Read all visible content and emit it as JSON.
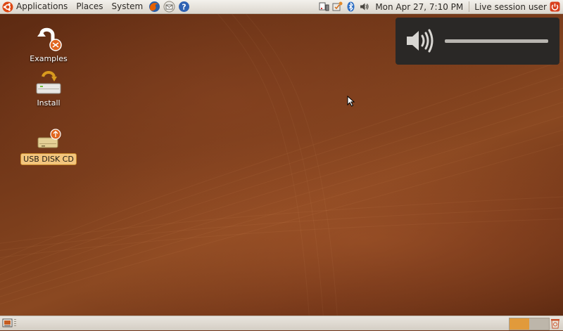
{
  "top_panel": {
    "menus": {
      "applications": "Applications",
      "places": "Places",
      "system": "System"
    },
    "launchers": [
      "firefox-icon",
      "mail-icon",
      "help-icon"
    ],
    "tray_icons": [
      "network-icon",
      "update-notifier-icon",
      "bluetooth-icon",
      "volume-icon"
    ],
    "clock": "Mon Apr 27,  7:10 PM",
    "user": "Live session user"
  },
  "desktop": {
    "icons": [
      {
        "label": "Examples",
        "icon": "examples-icon"
      },
      {
        "label": "Install",
        "icon": "install-icon"
      },
      {
        "label": "USB DISK CD",
        "icon": "usb-drive-icon",
        "selected": true
      }
    ]
  },
  "volume_osd": {
    "level": 1.0,
    "icon": "speaker-icon"
  },
  "bottom_panel": {
    "workspaces": [
      {
        "active": true
      },
      {
        "active": false
      }
    ]
  },
  "colors": {
    "accent": "#e19a3b",
    "panel": "#e6e2da",
    "wallpaper": "#763a1a"
  }
}
